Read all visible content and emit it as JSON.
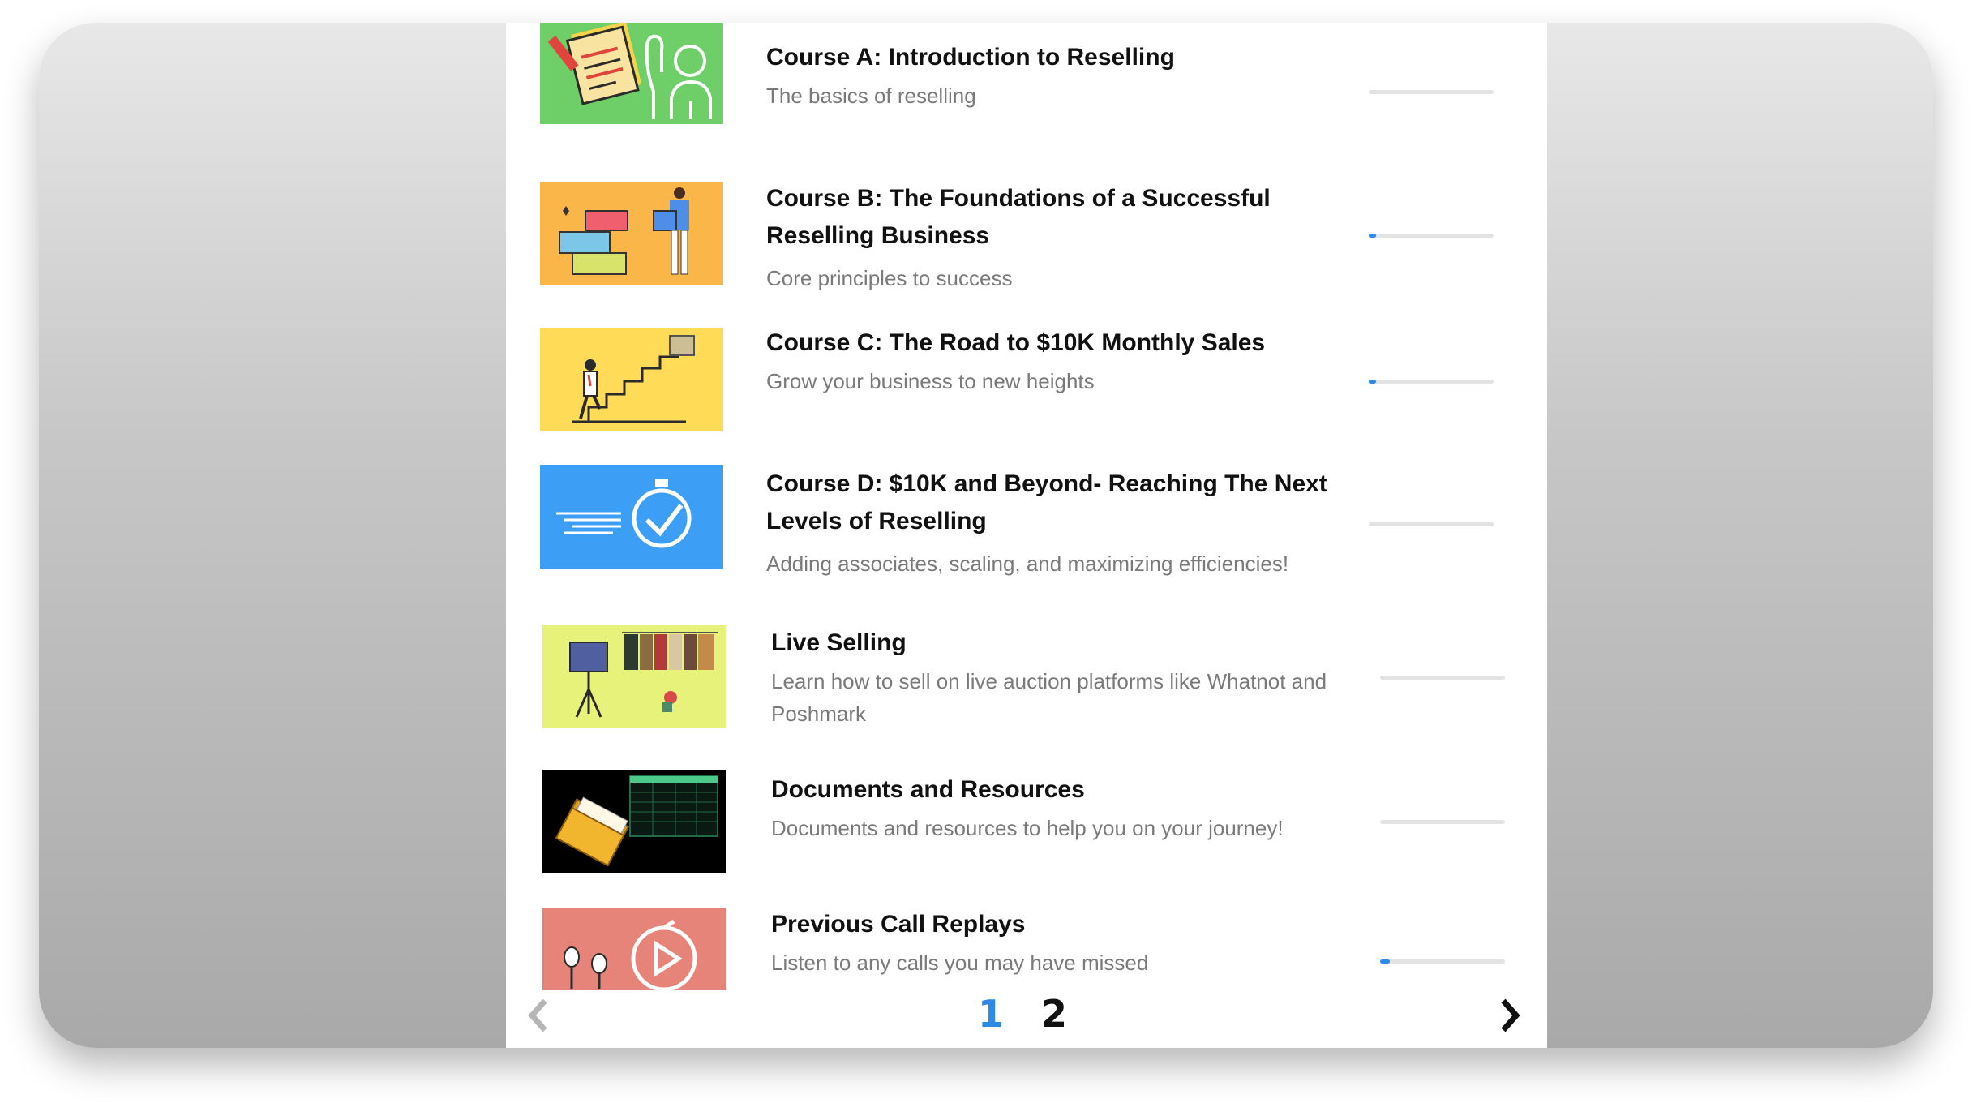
{
  "courses": [
    {
      "title": "Course A: Introduction to Reselling",
      "subtitle": "The basics of reselling",
      "progress": 0,
      "thumb_color": "#6ecf68"
    },
    {
      "title": "Course B: The Foundations of a Successful Reselling Business",
      "subtitle": "Core principles to success",
      "progress": 0.06,
      "thumb_color": "#fbb64a"
    },
    {
      "title": "Course C: The Road to $10K Monthly Sales",
      "subtitle": "Grow your business to new heights",
      "progress": 0.06,
      "thumb_color": "#ffdb58"
    },
    {
      "title": "Course D: $10K and Beyond- Reaching The Next Levels of Reselling",
      "subtitle": "Adding associates, scaling, and maximizing efficiencies!",
      "progress": 0,
      "thumb_color": "#3d9ef5"
    },
    {
      "title": "Live Selling",
      "subtitle": "Learn how to sell on live auction platforms like Whatnot and Poshmark",
      "progress": 0,
      "thumb_color": "#e6f27a"
    },
    {
      "title": "Documents and Resources",
      "subtitle": "Documents and resources to help you on your journey!",
      "progress": 0,
      "thumb_color": "#000000"
    },
    {
      "title": "Previous Call Replays",
      "subtitle": "Listen to any calls you may have missed",
      "progress": 0.08,
      "thumb_color": "#e6847a"
    }
  ],
  "pagination": {
    "page1": "1",
    "page2": "2",
    "current": "1",
    "active_color": "#2d8ae6"
  },
  "icons": {
    "prev": "chevron-left-icon",
    "next": "chevron-right-icon"
  }
}
